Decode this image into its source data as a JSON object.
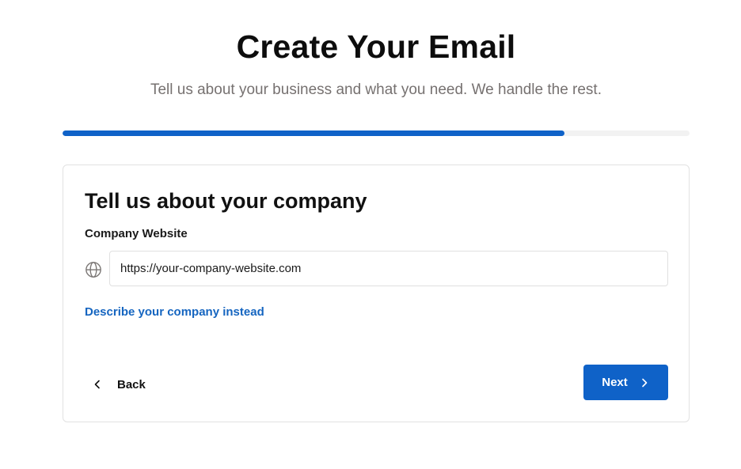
{
  "header": {
    "title": "Create Your Email",
    "subtitle": "Tell us about your business and what you need. We handle the rest."
  },
  "progress": {
    "fraction": 0.8
  },
  "colors": {
    "accent": "#0f62c8",
    "link": "#1565c0",
    "track": "#f2f2f2"
  },
  "form": {
    "heading": "Tell us about your company",
    "website_label": "Company Website",
    "website_placeholder": "https://your-company-website.com",
    "website_icon": "globe-icon",
    "describe_link": "Describe your company instead"
  },
  "actions": {
    "back_label": "Back",
    "back_icon": "chevron-left-icon",
    "next_label": "Next",
    "next_icon": "chevron-right-icon"
  }
}
